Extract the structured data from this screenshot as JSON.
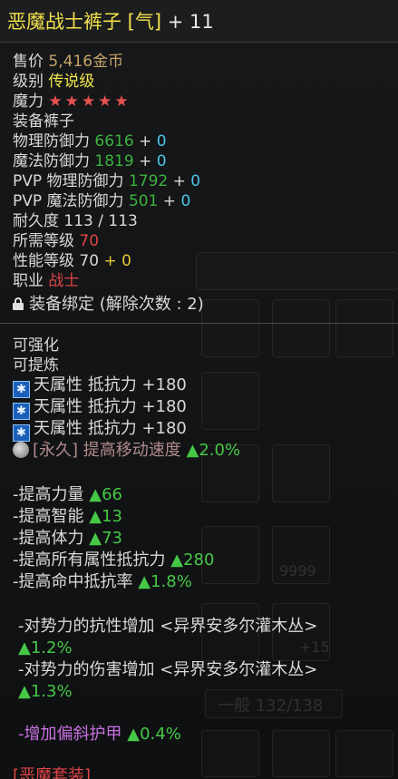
{
  "title": {
    "name": "恶魔战士裤子 [气]",
    "plus": " + 11"
  },
  "info": {
    "price_label": "售价",
    "price_value": "5,416",
    "price_unit": "金币",
    "grade_label": "级别",
    "grade_value": "传说级",
    "magic_label": "魔力",
    "magic_stars": "★★★★★",
    "equip_label": "装备",
    "equip_value": "裤子",
    "phys_def_label": "物理防御力",
    "phys_def_value": "6616",
    "phys_def_plus": " + ",
    "phys_def_bonus": "0",
    "mag_def_label": "魔法防御力",
    "mag_def_value": "1819",
    "mag_def_plus": " + ",
    "mag_def_bonus": "0",
    "pvp_phys_label": "PVP 物理防御力",
    "pvp_phys_value": "1792",
    "pvp_phys_plus": " + ",
    "pvp_phys_bonus": "0",
    "pvp_mag_label": "PVP 魔法防御力",
    "pvp_mag_value": "501",
    "pvp_mag_plus": " + ",
    "pvp_mag_bonus": "0",
    "durability_label": "耐久度",
    "durability_value": "113 / 113",
    "req_level_label": "所需等级",
    "req_level_value": "70",
    "perf_level_label": "性能等级",
    "perf_level_value": "70",
    "perf_level_plus": " + ",
    "perf_level_bonus": "0",
    "job_label": "职业",
    "job_value": "战士",
    "bind_text": "装备绑定 (解除次数 : 2)"
  },
  "props": {
    "enhance": "可强化",
    "refine": "可提炼",
    "resist_1": "天属性 抵抗力 +180",
    "resist_2": "天属性 抵抗力 +180",
    "resist_3": "天属性 抵抗力 +180",
    "speed_prefix": "[永久] 提高移动速度",
    "speed_value": "▲2.0%"
  },
  "stats": {
    "str_label": "-提高力量",
    "str_value": "▲66",
    "int_label": "-提高智能",
    "int_value": "▲13",
    "con_label": "-提高体力",
    "con_value": "▲73",
    "allres_label": "-提高所有属性抵抗力",
    "allres_value": "▲280",
    "hitres_label": "-提高命中抵抗率",
    "hitres_value": "▲1.8%"
  },
  "faction": {
    "resist_label": "-对势力的抗性增加  <异界安多尔灌木丛>",
    "resist_value": "▲1.2%",
    "damage_label": "-对势力的伤害增加  <异界安多尔灌木丛>",
    "damage_value": "▲1.3%"
  },
  "extra": {
    "armor_label": "-增加偏斜护甲",
    "armor_value": "▲0.4%",
    "set_label": "[恶魔套装]"
  },
  "ghost": {
    "inventory_text": "一般 132/138",
    "stack_text": "9999",
    "plus_text": "+15"
  }
}
